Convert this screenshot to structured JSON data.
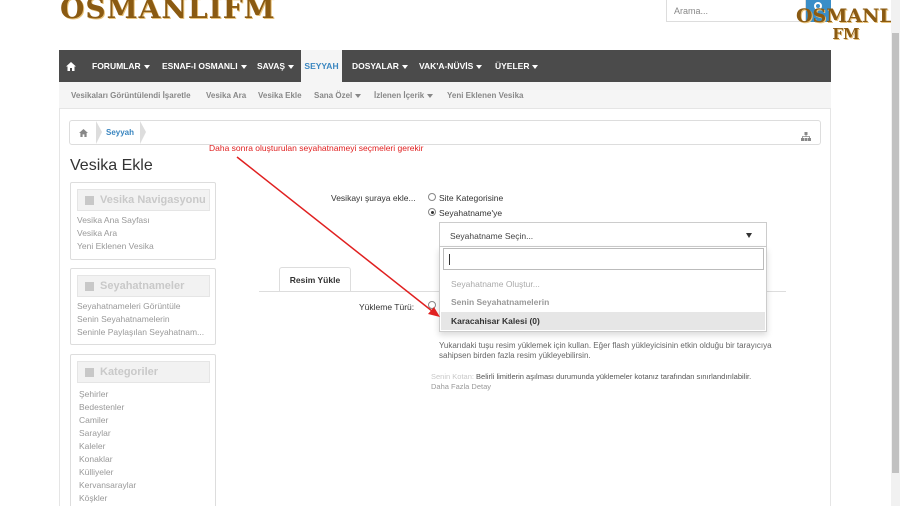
{
  "logo": {
    "left_text": "OSMANLIFM",
    "right_line1": "OSMANLI",
    "right_line2": "FM"
  },
  "search": {
    "placeholder": "Arama..."
  },
  "nav": {
    "items": [
      {
        "label": "FORUMLAR",
        "dropdown": true
      },
      {
        "label": "ESNAF-I OSMANLI",
        "dropdown": true
      },
      {
        "label": "SAVAŞ",
        "dropdown": true
      },
      {
        "label": "SEYYAH",
        "dropdown": false,
        "active": true
      },
      {
        "label": "DOSYALAR",
        "dropdown": true
      },
      {
        "label": "VAK'A-NÜVİS",
        "dropdown": true
      },
      {
        "label": "ÜYELER",
        "dropdown": true
      }
    ]
  },
  "subnav": {
    "items": [
      {
        "label": "Vesikaları Görüntülendi İşaretle"
      },
      {
        "label": "Vesika Ara"
      },
      {
        "label": "Vesika Ekle"
      },
      {
        "label": "Sana Özel",
        "dropdown": true
      },
      {
        "label": "İzlenen İçerik",
        "dropdown": true
      },
      {
        "label": "Yeni Eklenen Vesika"
      }
    ]
  },
  "breadcrumb": {
    "current": "Seyyah"
  },
  "annotation": "Daha sonra oluşturulan seyahatnameyi seçmeleri gerekir",
  "page_title": "Vesika Ekle",
  "sidebar": {
    "navigation": {
      "title": "Vesika Navigasyonu",
      "links": [
        "Vesika Ana Sayfası",
        "Vesika Ara",
        "Yeni Eklenen Vesika"
      ]
    },
    "travelogues": {
      "title": "Seyahatnameler",
      "links": [
        "Seyahatnameleri Görüntüle",
        "Senin Seyahatnamelerin",
        "Seninle Paylaşılan Seyahatnam..."
      ]
    },
    "categories": {
      "title": "Kategoriler",
      "links": [
        "Şehirler",
        "Bedestenler",
        "Camiler",
        "Saraylar",
        "Kaleler",
        "Konaklar",
        "Külliyeler",
        "Kervansaraylar",
        "Köşkler"
      ]
    }
  },
  "form": {
    "add_to_label": "Vesikayı şuraya ekle...",
    "option_site_category": "Site Kategorisine",
    "option_travelogue": "Seyahatname'ye",
    "select_placeholder": "Seyahatname Seçin...",
    "dropdown": {
      "search_value": "",
      "create_option": "Seyahatname Oluştur...",
      "group_label": "Senin Seyahatnamelerin",
      "options": [
        "Karacahisar Kalesi (0)"
      ]
    },
    "tab_label": "Resim Yükle",
    "upload_type_label": "Yükleme Türü:",
    "help_text": "Yukarıdaki tuşu resim yüklemek için kullan. Eğer flash yükleyicisinin etkin olduğu bir tarayıcıya sahipsen birden fazla resim yükleyebilirsin.",
    "quota_label": "Senin Kotan:",
    "quota_text": "Belirli limitlerin aşılması durumunda yüklemeler kotanız tarafından sınırlandırılabilir.",
    "more_detail": "Daha Fazla Detay"
  },
  "colors": {
    "nav_bg": "#4b4b4b",
    "accent": "#3a86c0",
    "annotation": "#e02020",
    "logo": "#8a5a12"
  }
}
